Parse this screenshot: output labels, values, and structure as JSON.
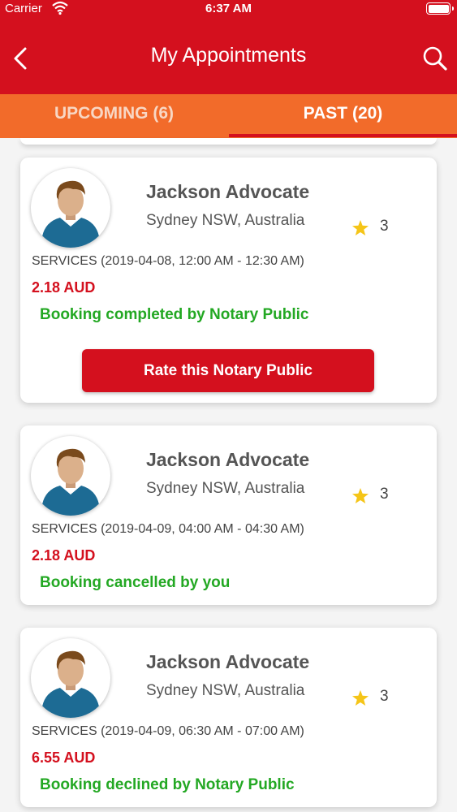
{
  "status_bar": {
    "carrier": "Carrier",
    "time": "6:37 AM"
  },
  "header": {
    "title": "My Appointments",
    "back_icon": "chevron-left-icon",
    "search_icon": "search-icon"
  },
  "tabs": [
    {
      "label": "UPCOMING (6)",
      "active": false
    },
    {
      "label": "PAST (20)",
      "active": true
    }
  ],
  "colors": {
    "primary": "#d4101e",
    "tab_bar": "#f26b2a",
    "success": "#23a823",
    "star": "#f5c518"
  },
  "appointments": [
    {
      "name": "Jackson Advocate",
      "location": "Sydney NSW, Australia",
      "rating": "3",
      "services": "SERVICES (2019-04-08, 12:00 AM - 12:30 AM)",
      "price": "2.18 AUD",
      "status": "Booking completed by Notary Public",
      "action_label": "Rate this Notary Public"
    },
    {
      "name": "Jackson Advocate",
      "location": "Sydney NSW, Australia",
      "rating": "3",
      "services": "SERVICES (2019-04-09, 04:00 AM - 04:30 AM)",
      "price": "2.18 AUD",
      "status": "Booking cancelled by you"
    },
    {
      "name": "Jackson Advocate",
      "location": "Sydney NSW, Australia",
      "rating": "3",
      "services": "SERVICES (2019-04-09, 06:30 AM - 07:00 AM)",
      "price": "6.55 AUD",
      "status": "Booking declined by Notary Public"
    }
  ]
}
